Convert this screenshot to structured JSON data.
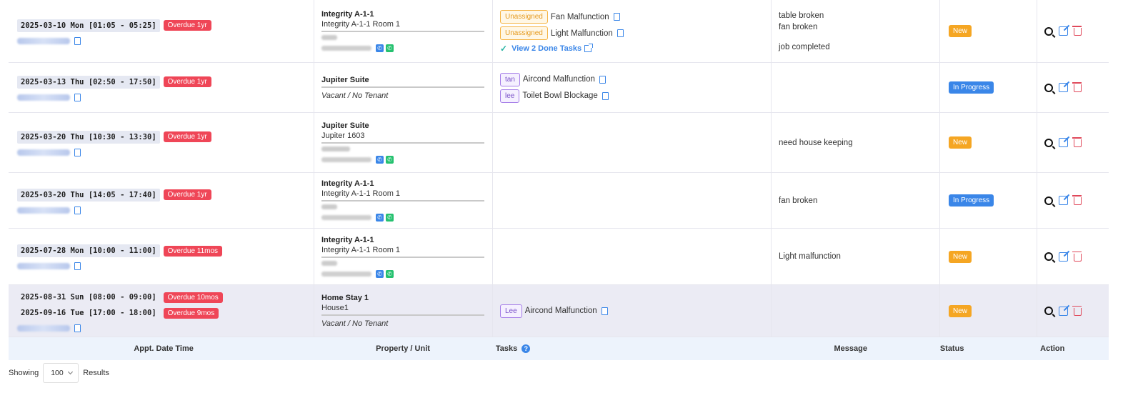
{
  "rows": [
    {
      "appts": [
        {
          "datetime": "2025-03-10 Mon [01:05 - 05:25]",
          "overdue": "Overdue 1yr"
        }
      ],
      "property": "Integrity A-1-1",
      "unit": "Integrity A-1-1 Room 1",
      "tenant": "blurred",
      "tasks": [
        {
          "assignee": "Unassigned",
          "kind": "unassigned",
          "name": "Fan Malfunction"
        },
        {
          "assignee": "Unassigned",
          "kind": "unassigned",
          "name": "Light Malfunction"
        }
      ],
      "done_link": "View 2 Done Tasks",
      "messages": [
        "table broken",
        "fan broken",
        "",
        "job completed"
      ],
      "status": "New"
    },
    {
      "appts": [
        {
          "datetime": "2025-03-13 Thu [02:50 - 17:50]",
          "overdue": "Overdue 1yr"
        }
      ],
      "property": "Jupiter Suite",
      "vacant": "Vacant / No Tenant",
      "tasks": [
        {
          "assignee": "tan",
          "kind": "person",
          "name": "Aircond Malfunction"
        },
        {
          "assignee": "lee",
          "kind": "person",
          "name": "Toilet Bowl Blockage"
        }
      ],
      "messages": [],
      "status": "In Progress"
    },
    {
      "appts": [
        {
          "datetime": "2025-03-20 Thu [10:30 - 13:30]",
          "overdue": "Overdue 1yr"
        }
      ],
      "property": "Jupiter Suite",
      "unit": "Jupiter 1603",
      "tenant": "blurred",
      "tasks": [],
      "messages": [
        "need house keeping"
      ],
      "status": "New"
    },
    {
      "appts": [
        {
          "datetime": "2025-03-20 Thu [14:05 - 17:40]",
          "overdue": "Overdue 1yr"
        }
      ],
      "property": "Integrity A-1-1",
      "unit": "Integrity A-1-1 Room 1",
      "tenant": "blurred",
      "tasks": [],
      "messages": [
        "fan broken"
      ],
      "status": "In Progress"
    },
    {
      "appts": [
        {
          "datetime": "2025-07-28 Mon [10:00 - 11:00]",
          "overdue": "Overdue 11mos"
        }
      ],
      "property": "Integrity A-1-1",
      "unit": "Integrity A-1-1 Room 1",
      "tenant": "blurred",
      "tasks": [],
      "messages": [
        "Light malfunction"
      ],
      "status": "New"
    },
    {
      "appts": [
        {
          "datetime": "2025-08-31 Sun [08:00 - 09:00]",
          "overdue": "Overdue 10mos"
        },
        {
          "datetime": "2025-09-16 Tue [17:00 - 18:00]",
          "overdue": "Overdue 9mos"
        }
      ],
      "property": "Home Stay 1",
      "unit": "House1",
      "vacant": "Vacant / No Tenant",
      "tasks": [
        {
          "assignee": "Lee",
          "kind": "person",
          "name": "Aircond Malfunction"
        }
      ],
      "messages": [],
      "status": "New",
      "highlighted": true
    }
  ],
  "columns": {
    "appt": "Appt. Date Time",
    "property": "Property / Unit",
    "tasks": "Tasks",
    "message": "Message",
    "status": "Status",
    "action": "Action"
  },
  "footer": {
    "showing": "Showing",
    "page_size": "100",
    "results": "Results"
  },
  "colors": {
    "overdue": "#ef4657",
    "new": "#f5a623",
    "in_progress": "#3a86e8",
    "accent": "#3a86e8"
  }
}
